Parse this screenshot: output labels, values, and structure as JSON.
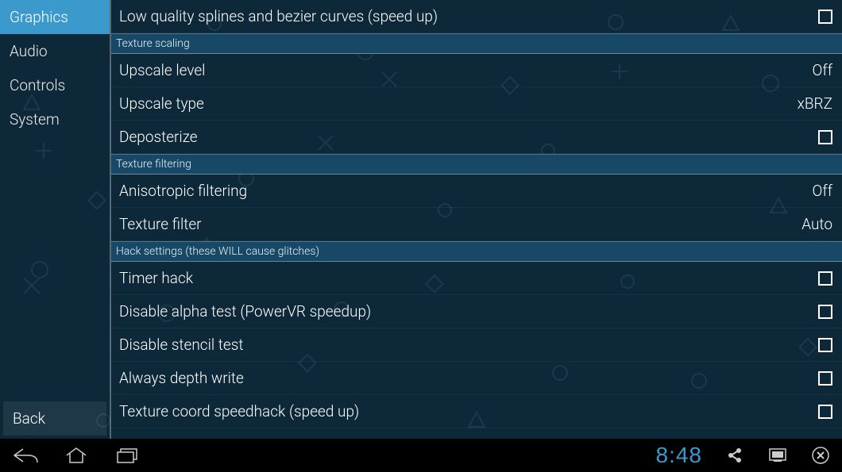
{
  "sidebar": {
    "items": [
      {
        "label": "Graphics",
        "active": true
      },
      {
        "label": "Audio",
        "active": false
      },
      {
        "label": "Controls",
        "active": false
      },
      {
        "label": "System",
        "active": false
      }
    ],
    "back_label": "Back"
  },
  "settings": {
    "top_row": {
      "label": "Low quality splines and bezier curves (speed up)",
      "type": "checkbox"
    },
    "sections": [
      {
        "title": "Texture scaling",
        "rows": [
          {
            "label": "Upscale level",
            "type": "value",
            "value": "Off"
          },
          {
            "label": "Upscale type",
            "type": "value",
            "value": "xBRZ"
          },
          {
            "label": "Deposterize",
            "type": "checkbox"
          }
        ]
      },
      {
        "title": "Texture filtering",
        "rows": [
          {
            "label": "Anisotropic filtering",
            "type": "value",
            "value": "Off"
          },
          {
            "label": "Texture filter",
            "type": "value",
            "value": "Auto"
          }
        ]
      },
      {
        "title": "Hack settings (these WILL cause glitches)",
        "rows": [
          {
            "label": "Timer hack",
            "type": "checkbox"
          },
          {
            "label": "Disable alpha test (PowerVR speedup)",
            "type": "checkbox"
          },
          {
            "label": "Disable stencil test",
            "type": "checkbox"
          },
          {
            "label": "Always depth write",
            "type": "checkbox"
          },
          {
            "label": "Texture coord speedhack (speed up)",
            "type": "checkbox"
          }
        ]
      }
    ]
  },
  "navbar": {
    "clock": "8:48"
  }
}
